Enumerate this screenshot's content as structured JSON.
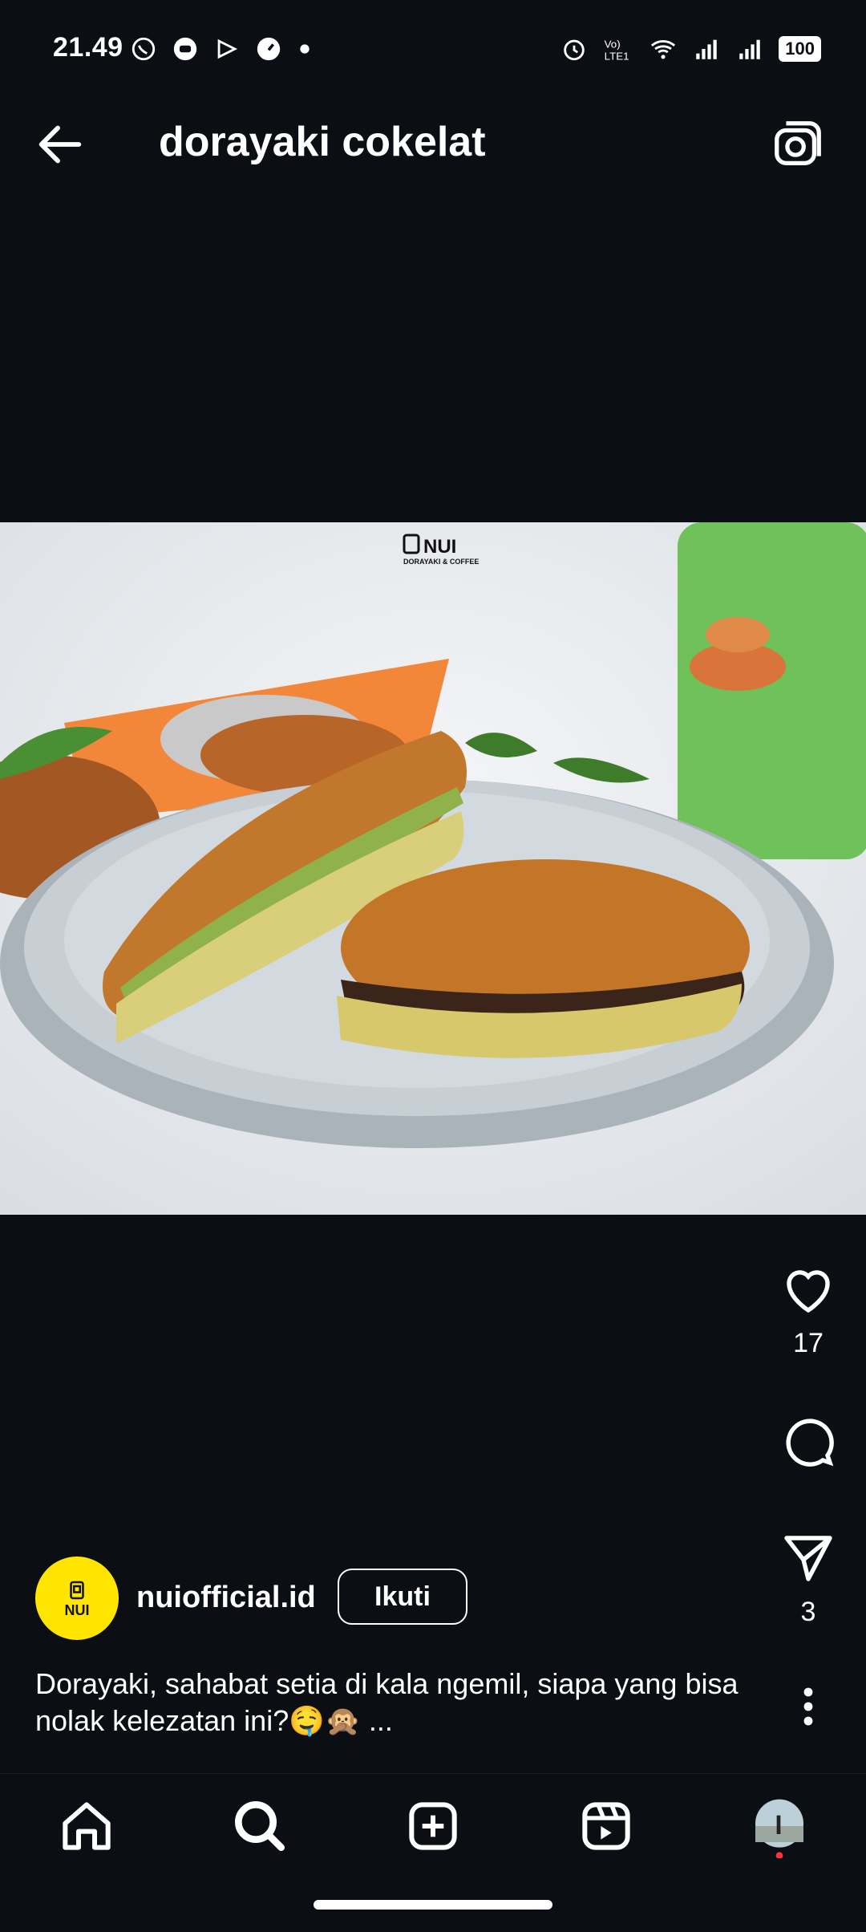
{
  "status_bar": {
    "time": "21.49",
    "left_icons": [
      "whatsapp-icon",
      "chat-icon",
      "play-icon",
      "speedometer-icon",
      "dot-icon"
    ],
    "right_icons": [
      "alarm-icon",
      "volte-icon",
      "wifi-icon",
      "signal-icon",
      "signal-icon-2"
    ],
    "battery": "100"
  },
  "header": {
    "title": "dorayaki cokelat",
    "back_icon": "arrow-left-icon",
    "camera_icon": "camera-icon"
  },
  "post": {
    "image_brand": {
      "name": "NUI",
      "tagline": "DORAYAKI & COFFEE"
    },
    "likes": "17",
    "shares": "3",
    "author": {
      "avatar_text": "NUI",
      "username": "nuiofficial.id",
      "follow_label": "Ikuti"
    },
    "caption": "Dorayaki, sahabat setia di kala ngemil, siapa yang bisa nolak kelezatan ini?🤤🙊 ..."
  },
  "bottom_nav": [
    "home-icon",
    "search-icon",
    "create-icon",
    "reels-icon",
    "profile-avatar"
  ],
  "colors": {
    "background": "#0b0f14",
    "accent_dot": "#ff3040"
  }
}
